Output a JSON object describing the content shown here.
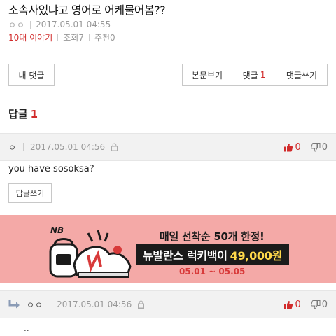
{
  "post": {
    "title": "소속사있냐고 영어로 어케물어봄??",
    "author": "ㅇㅇ",
    "date": "2017.05.01 04:55",
    "category": "10대 이야기",
    "views": "조회7",
    "recommends": "추천0"
  },
  "buttons": {
    "my_comments": "내 댓글",
    "view_post": "본문보기",
    "comments_label": "댓글",
    "comments_count": "1",
    "write_comment": "댓글쓰기"
  },
  "replies": {
    "heading": "답글",
    "count": "1"
  },
  "comments": [
    {
      "author": "ㅇ",
      "date": "2017.05.01 04:56",
      "up": "0",
      "down": "0",
      "body": "you have sosoksa?",
      "reply_button": "답글쓰기"
    },
    {
      "author": "ㅇㅇ",
      "date": "2017.05.01 04:56",
      "up": "0",
      "down": "0",
      "body": ".."
    }
  ],
  "banner": {
    "line1": "매일 선착순 50개 한정!",
    "line2": "뉴발란스 럭키백이",
    "price": "49,000원",
    "period": "05.01 ~ 05.05",
    "brand_mark": "NB",
    "background": "#f4a9a7"
  },
  "colors": {
    "accent": "#d12b2b",
    "muted": "#999999"
  }
}
